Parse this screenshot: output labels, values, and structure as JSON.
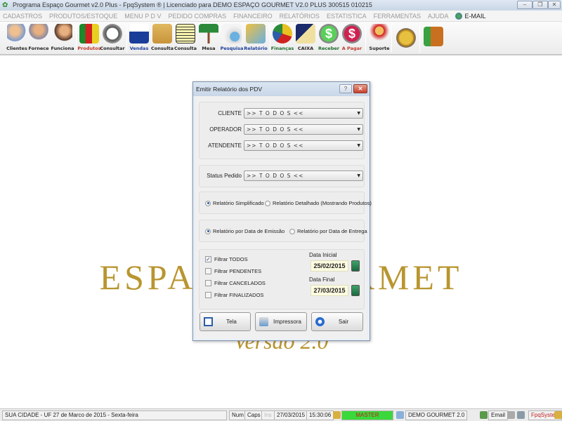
{
  "window": {
    "title": "Programa Espaço Gourmet v2.0 Plus - FpqSystem ® | Licenciado para  DEMO ESPAÇO GOURMET V2.0 PLUS 300515 010215",
    "minimize": "–",
    "restore": "❐",
    "close": "✕"
  },
  "menu": [
    "CADASTROS",
    "PRODUTOS/ESTOQUE",
    "MENU P D V",
    "PEDIDO COMPRAS",
    "FINANCEIRO",
    "RELATÓRIOS",
    "ESTATISTICA",
    "FERRAMENTAS",
    "AJUDA"
  ],
  "menu_email": "E-MAIL",
  "toolbar": [
    {
      "label": "Clientes",
      "color": "#333"
    },
    {
      "label": "Fornece",
      "color": "#333"
    },
    {
      "label": "Funciona",
      "color": "#333"
    },
    {
      "label": "Produtos",
      "color": "#c0392b"
    },
    {
      "label": "Consultar",
      "color": "#333"
    },
    {
      "label": "Vendas",
      "color": "#1a3d9a"
    },
    {
      "label": "Consulta",
      "color": "#333"
    },
    {
      "label": "Consulta",
      "color": "#333"
    },
    {
      "label": "Mesa",
      "color": "#333"
    },
    {
      "label": "Pesquisa",
      "color": "#1a3d9a"
    },
    {
      "label": "Relatório",
      "color": "#1a3d9a"
    },
    {
      "label": "Finanças",
      "color": "#1a6a2a"
    },
    {
      "label": "CAIXA",
      "color": "#333"
    },
    {
      "label": "Receber",
      "color": "#1a6a2a"
    },
    {
      "label": "A Pagar",
      "color": "#c0392b"
    },
    {
      "label": "Suporte",
      "color": "#333"
    }
  ],
  "background": {
    "logo": "ESPAÇO GOURMET",
    "version": "Versão 2.0"
  },
  "dialog": {
    "title": "Emitir Relatório dos PDV",
    "help": "?",
    "close": "✕",
    "filters": [
      {
        "label": "CLIENTE",
        "value": ">> T O D O S <<"
      },
      {
        "label": "OPERADOR",
        "value": ">> T O D O S <<"
      },
      {
        "label": "ATENDENTE",
        "value": ">> T O D O S <<"
      }
    ],
    "status": {
      "label": "Status Pedido",
      "value": ">> T O D O S <<"
    },
    "report_type": {
      "options": [
        "Relatório Simplificado",
        "Relatório Detalhado (Mostrando Produtos)"
      ],
      "selected": 0
    },
    "date_type": {
      "options": [
        "Relatório por Data de Emissão",
        "Relatório por Data de Entrega"
      ],
      "selected": 0
    },
    "checkboxes": [
      {
        "label": "Filtrar TODOS",
        "checked": true
      },
      {
        "label": "Filtrar PENDENTES",
        "checked": false
      },
      {
        "label": "Filtrar CANCELADOS",
        "checked": false
      },
      {
        "label": "Filtrar FINALIZADOS",
        "checked": false
      }
    ],
    "start_date": {
      "label": "Data Inicial",
      "value": "25/02/2015"
    },
    "end_date": {
      "label": "Data Final",
      "value": "27/03/2015"
    },
    "buttons": {
      "screen": "Tela",
      "printer": "Impressora",
      "exit": "Sair"
    }
  },
  "status": {
    "location": "SUA CIDADE - UF 27 de Marco de 2015 - Sexta-feira",
    "num": "Num",
    "caps": "Caps",
    "ins": "Ins",
    "date": "27/03/2015",
    "time": "15:30:06",
    "user": "MASTER",
    "company": "DEMO GOURMET 2.0",
    "email": "Email",
    "brand": "FpqSystem"
  }
}
